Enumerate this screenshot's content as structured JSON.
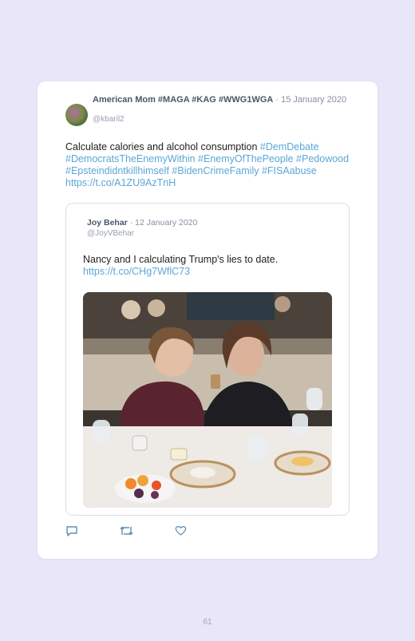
{
  "tweet": {
    "author_name": "American Mom #MAGA #KAG #WWG1WGA",
    "separator": " · ",
    "date": "15 January 2020",
    "handle": "@kbaril2",
    "text_plain": "Calculate calories and alcohol consumption ",
    "hashtags": [
      "#DemDebate",
      "#DemocratsTheEnemyWithin",
      "#EnemyOfThePeople",
      "#Pedowood",
      "#Epsteindidntkillhimself",
      "#BidenCrimeFamily",
      "#FISAabuse"
    ],
    "link": "https://t.co/A1ZU9AzTnH"
  },
  "quoted": {
    "author_name": "Joy Behar",
    "separator": " · ",
    "date": "12 January 2020",
    "handle": "@JoyVBehar",
    "text": "Nancy and I calculating Trump's lies to date.",
    "link": "https://t.co/CHg7WflC73"
  },
  "actions": {
    "reply_icon": "reply-icon",
    "retweet_icon": "retweet-icon",
    "like_icon": "heart-icon"
  },
  "colors": {
    "background": "#e8e6f8",
    "link": "#5aa7d8",
    "name": "#4b5568"
  },
  "page_number": "61"
}
